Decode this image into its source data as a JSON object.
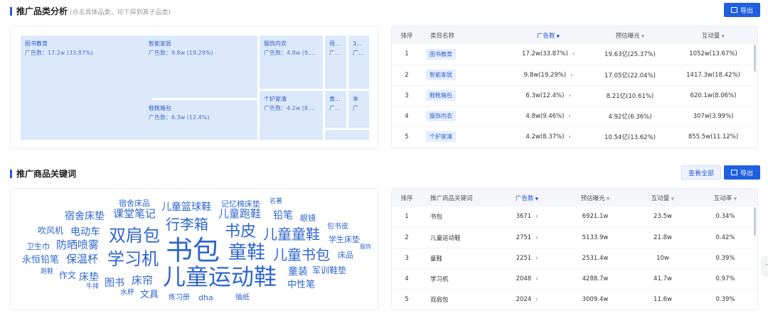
{
  "section1": {
    "title": "推广品类分析",
    "subtitle": "(点击具体品类，可下探到其子品类)",
    "export_label": "导出"
  },
  "treemap": [
    {
      "name": "图书教育",
      "value": "广告数：17.2w (33.87%)"
    },
    {
      "name": "智能家居",
      "value": "广告数：9.8w (19.29%)"
    },
    {
      "name": "服饰内衣",
      "value": "广告数：4.8w (9...."
    },
    {
      "name": "母...",
      "value": "广..."
    },
    {
      "name": "3...",
      "value": "广..."
    },
    {
      "name": "鞋靴箱包",
      "value": "广告数：6.3w (12.4%)"
    },
    {
      "name": "个护家清",
      "value": "广告数：4.2w (8...."
    },
    {
      "name": "食...",
      "value": "广..."
    },
    {
      "name": "本",
      "value": "广"
    }
  ],
  "category_table": {
    "headers": {
      "rank": "排序",
      "name": "类目名称",
      "ads": "广告数",
      "exposure": "预估曝光",
      "interaction": "互动量"
    },
    "rows": [
      {
        "rank": "1",
        "name": "图书教育",
        "ads": "17.2w(33.87%)",
        "exposure": "19.63亿(25.37%)",
        "interaction": "1052w(13.67%)"
      },
      {
        "rank": "2",
        "name": "智能家居",
        "ads": "9.8w(19.29%)",
        "exposure": "17.05亿(22.04%)",
        "interaction": "1417.3w(18.42%)"
      },
      {
        "rank": "3",
        "name": "鞋靴箱包",
        "ads": "6.3w(12.4%)",
        "exposure": "8.21亿(10.61%)",
        "interaction": "620.1w(8.06%)"
      },
      {
        "rank": "4",
        "name": "服饰内衣",
        "ads": "4.8w(9.46%)",
        "exposure": "4.92亿(6.36%)",
        "interaction": "307w(3.99%)"
      },
      {
        "rank": "5",
        "name": "个护家清",
        "ads": "4.2w(8.37%)",
        "exposure": "10.54亿(13.62%)",
        "interaction": "855.5w(11.12%)"
      }
    ]
  },
  "section2": {
    "title": "推广商品关键词",
    "viewall_label": "查看全部",
    "export_label": "导出"
  },
  "keyword_table": {
    "headers": {
      "rank": "排序",
      "keyword": "推广商品关键词",
      "ads": "广告数",
      "exposure": "预估曝光",
      "interaction": "互动量",
      "rate": "互动率"
    },
    "rows": [
      {
        "rank": "1",
        "keyword": "书包",
        "ads": "3671",
        "exposure": "6921.1w",
        "interaction": "23.5w",
        "rate": "0.34%"
      },
      {
        "rank": "2",
        "keyword": "儿童运动鞋",
        "ads": "2751",
        "exposure": "5133.9w",
        "interaction": "21.8w",
        "rate": "0.42%"
      },
      {
        "rank": "3",
        "keyword": "童鞋",
        "ads": "2251",
        "exposure": "2531.4w",
        "interaction": "10w",
        "rate": "0.39%"
      },
      {
        "rank": "4",
        "keyword": "学习机",
        "ads": "2048",
        "exposure": "4288.7w",
        "interaction": "41.7w",
        "rate": "0.97%"
      },
      {
        "rank": "5",
        "keyword": "双肩包",
        "ads": "2024",
        "exposure": "3009.4w",
        "interaction": "11.6w",
        "rate": "0.39%"
      }
    ]
  },
  "word_cloud": {
    "w0": "书包",
    "w1": "儿童运动鞋",
    "w2": "童鞋",
    "w3": "学习机",
    "w4": "双肩包",
    "w5": "行李箱",
    "w6": "书皮",
    "w7": "儿童童鞋",
    "w8": "儿童书包",
    "w9": "课堂笔记",
    "w10": "宿舍床垫",
    "w11": "儿童篮球鞋",
    "w12": "儿童跑鞋",
    "w13": "记忆棉床垫",
    "w14": "宿舍床品",
    "w15": "名著",
    "w16": "铅笔",
    "w17": "眼镜",
    "w18": "包书皮",
    "w19": "学生床垫",
    "w20": "服饰",
    "w21": "床品",
    "w22": "吹风机",
    "w23": "电动车",
    "w24": "卫生巾",
    "w25": "防晒喷雾",
    "w26": "永恒铅笔",
    "w27": "保温杯",
    "w28": "跑鞋",
    "w29": "作文",
    "w30": "床垫",
    "w31": "牛排",
    "w32": "图书",
    "w33": "床帘",
    "w34": "水杯",
    "w35": "文具",
    "w36": "童装",
    "w37": "军训鞋垫",
    "w38": "中性笔",
    "w39": "练习册",
    "w40": "dha",
    "w41": "抽纸"
  },
  "colors": {
    "accent": "#1f5fe0",
    "tile": "#dce9fb",
    "word": "#2f66d0"
  }
}
